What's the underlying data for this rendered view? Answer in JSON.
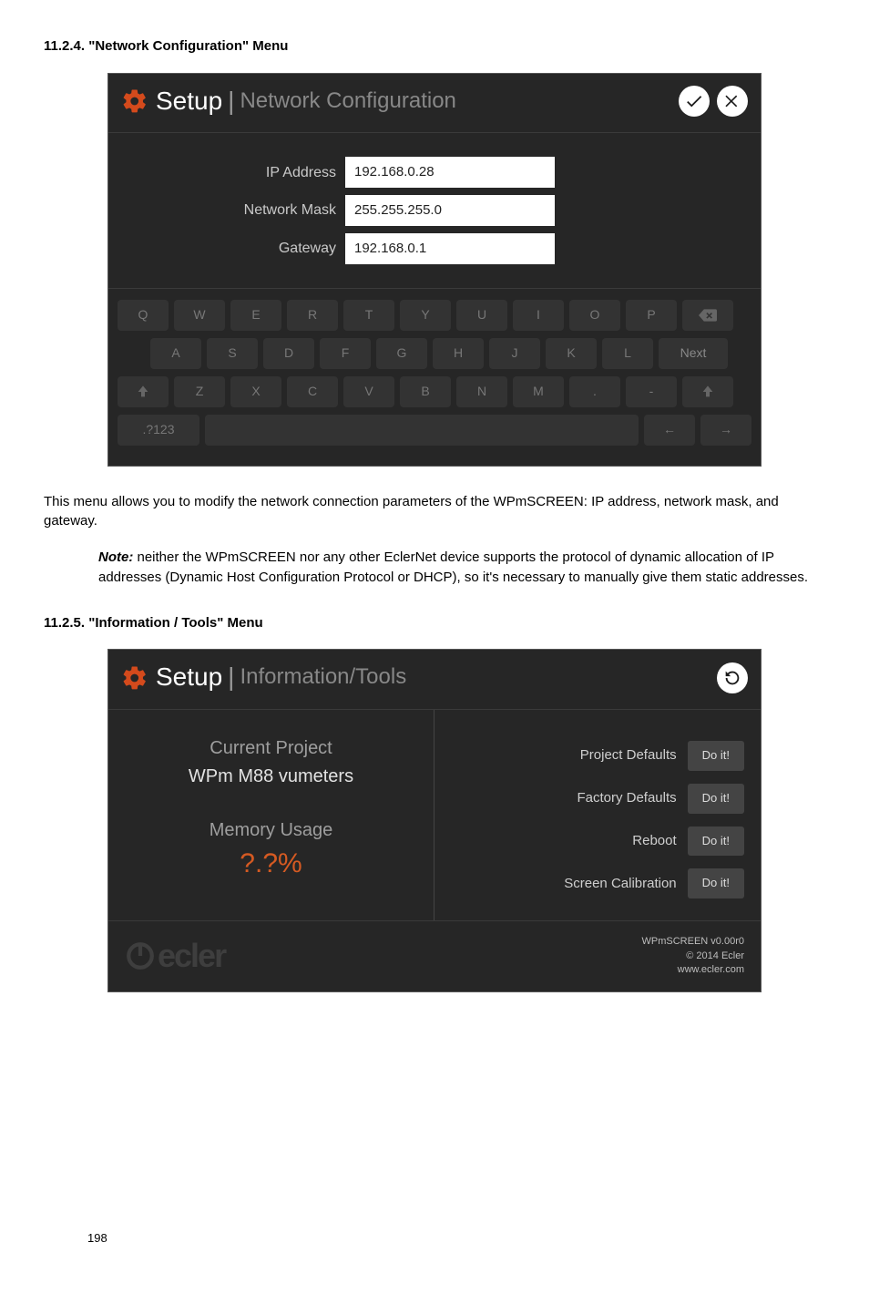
{
  "doc": {
    "heading1": "11.2.4. \"Network Configuration\" Menu",
    "heading2": "11.2.5. \"Information / Tools\" Menu",
    "para1": "This menu allows you to modify the network connection parameters of the WPmSCREEN: IP address, network mask, and gateway.",
    "note_label": "Note:",
    "note_text": " neither the WPmSCREEN nor any other EclerNet device supports the protocol of dynamic allocation of IP addresses (Dynamic Host Configuration Protocol or DHCP), so it's necessary to manually give them static addresses.",
    "page_number": "198"
  },
  "net_screen": {
    "title_main": "Setup",
    "title_sub": "Network Configuration",
    "fields": {
      "ip_label": "IP Address",
      "ip_value": "192.168.0.28",
      "mask_label": "Network Mask",
      "mask_value": "255.255.255.0",
      "gw_label": "Gateway",
      "gw_value": "192.168.0.1"
    },
    "keyboard": {
      "row1": [
        "Q",
        "W",
        "E",
        "R",
        "T",
        "Y",
        "U",
        "I",
        "O",
        "P"
      ],
      "row2": [
        "A",
        "S",
        "D",
        "F",
        "G",
        "H",
        "J",
        "K",
        "L"
      ],
      "row2_next": "Next",
      "row3": [
        "Z",
        "X",
        "C",
        "V",
        "B",
        "N",
        "M",
        ".",
        "-"
      ],
      "row4_mode": ".?123",
      "row4_left": "←",
      "row4_right": "→"
    }
  },
  "info_screen": {
    "title_main": "Setup",
    "title_sub": "Information/Tools",
    "left": {
      "cp_label": "Current Project",
      "cp_value": "WPm M88 vumeters",
      "mu_label": "Memory Usage",
      "mu_value": "?.?%"
    },
    "actions": {
      "project_defaults": "Project Defaults",
      "factory_defaults": "Factory Defaults",
      "reboot": "Reboot",
      "screen_calibration": "Screen Calibration",
      "doit": "Do it!"
    },
    "footer": {
      "logo_text": "ecler",
      "version": "WPmSCREEN v0.00r0",
      "copyright": "© 2014 Ecler",
      "url": "www.ecler.com"
    }
  }
}
